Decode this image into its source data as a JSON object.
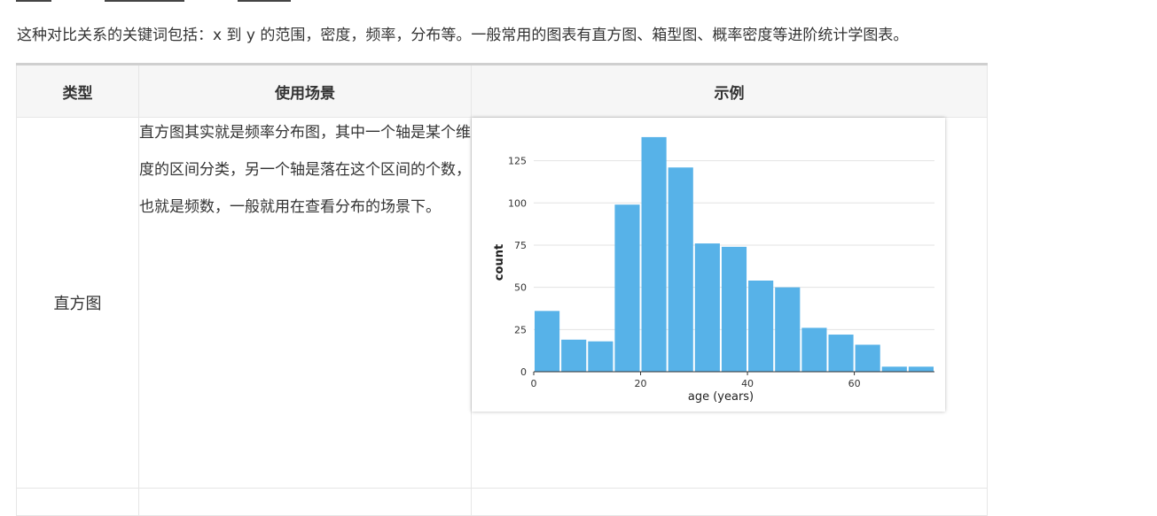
{
  "intro_text": "这种对比关系的关键词包括：x 到 y 的范围，密度，频率，分布等。一般常用的图表有直方图、箱型图、概率密度等进阶统计学图表。",
  "table": {
    "headers": [
      "类型",
      "使用场景",
      "示例"
    ],
    "rows": [
      {
        "type": "直方图",
        "description": "直方图其实就是频率分布图，其中一个轴是某个维度的区间分类，另一个轴是落在这个区间的个数，也就是频数，一般就用在查看分布的场景下。"
      }
    ]
  },
  "chart_data": {
    "type": "bar",
    "xlabel": "age (years)",
    "ylabel": "count",
    "xlim": [
      0,
      75
    ],
    "ylim": [
      0,
      140
    ],
    "x_ticks": [
      0,
      20,
      40,
      60
    ],
    "y_ticks": [
      0,
      25,
      50,
      75,
      100,
      125
    ],
    "bin_width": 5,
    "bins_start": [
      0,
      5,
      10,
      15,
      20,
      25,
      30,
      35,
      40,
      45,
      50,
      55,
      60,
      65,
      70
    ],
    "values": [
      36,
      19,
      18,
      99,
      139,
      121,
      76,
      74,
      54,
      50,
      26,
      22,
      16,
      3,
      3
    ],
    "bar_color": "#57b2e8",
    "grid": true
  }
}
